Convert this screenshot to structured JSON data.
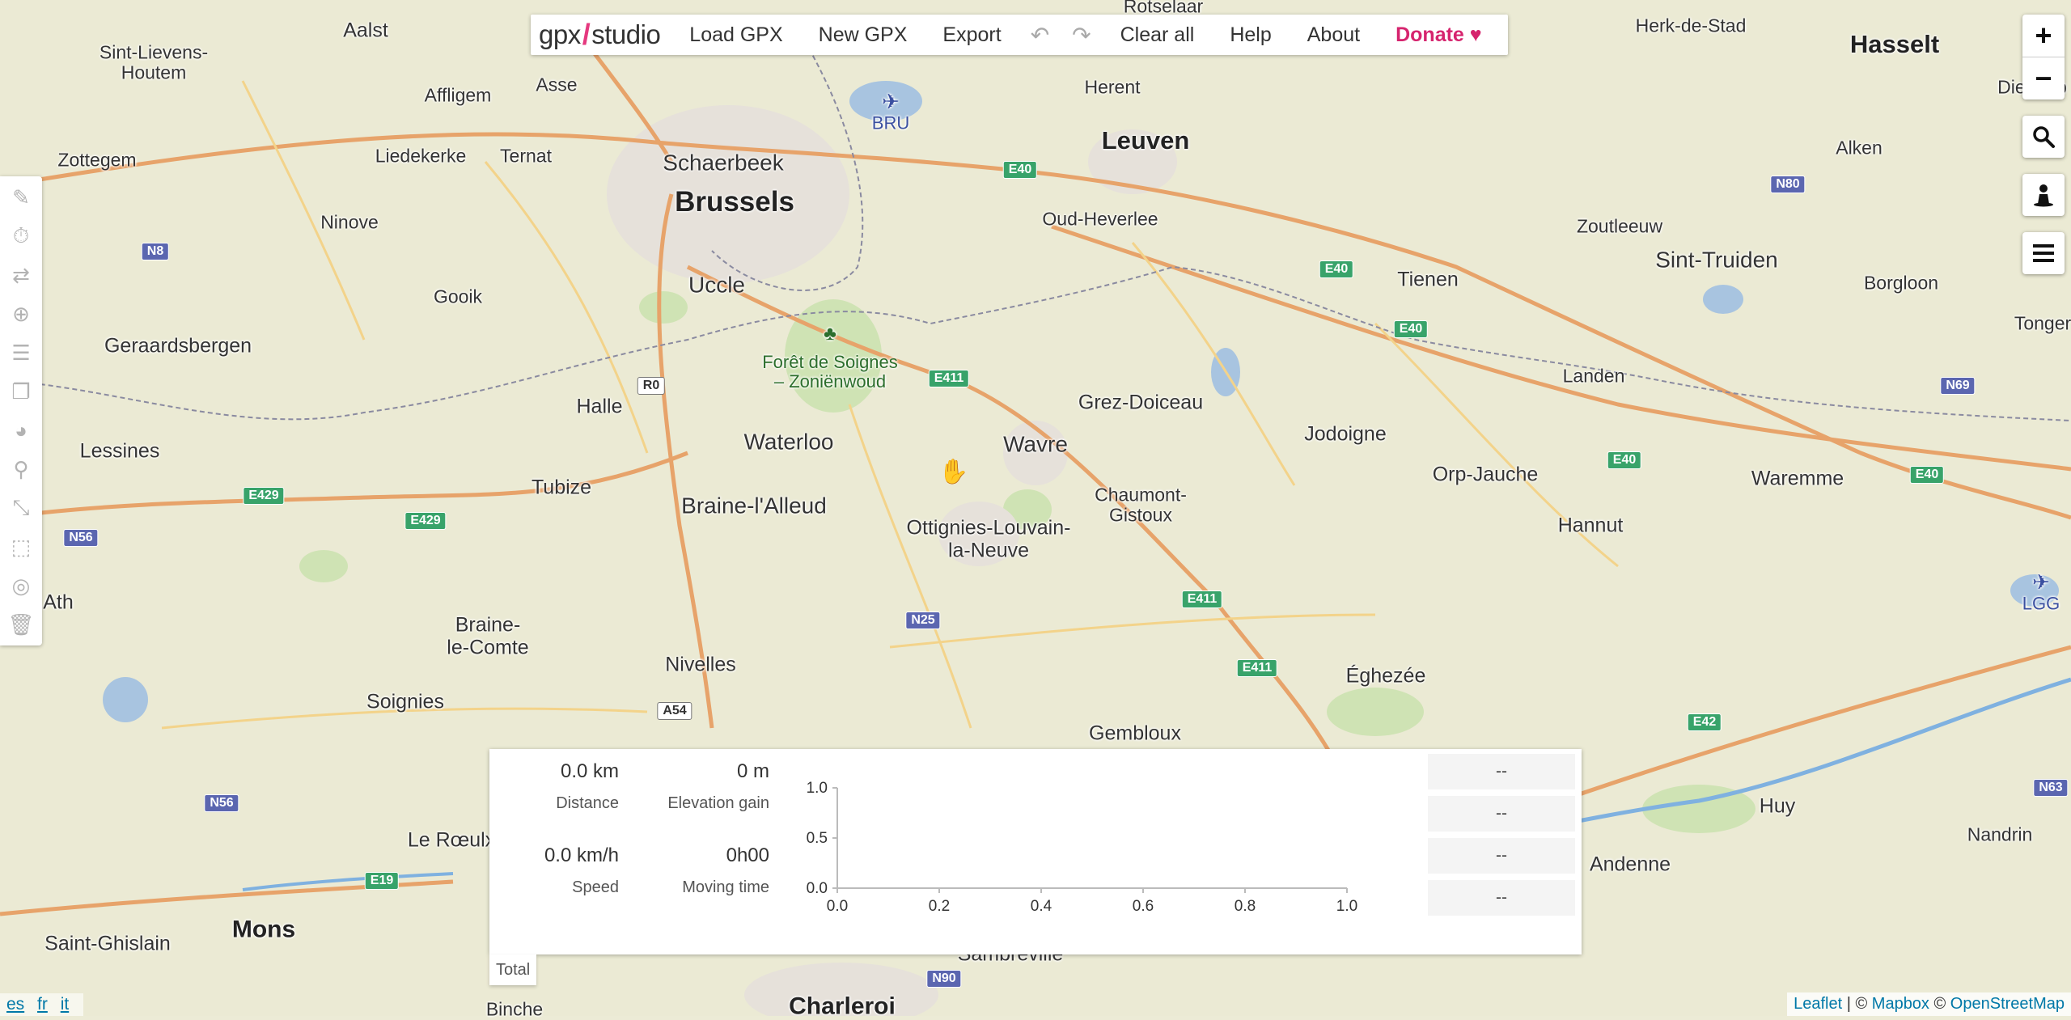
{
  "menu": {
    "logo_left": "gpx",
    "logo_right": "studio",
    "items": [
      "Load GPX",
      "New GPX",
      "Export"
    ],
    "undo_icon": "undo-icon",
    "redo_icon": "redo-icon",
    "items2": [
      "Clear all",
      "Help",
      "About"
    ],
    "donate": "Donate",
    "donate_icon": "heart-icon",
    "accent": "#d6246e"
  },
  "left_tools": [
    "pencil-icon",
    "stopwatch-icon",
    "reverse-icon",
    "add-circle-icon",
    "list-icon",
    "copy-icon",
    "palette-icon",
    "pin-icon",
    "compress-icon",
    "crop-icon",
    "eye-slash-icon",
    "trash-icon"
  ],
  "right_controls": {
    "zoom_in": "+",
    "zoom_out": "−",
    "search_icon": "search-icon",
    "street_view_icon": "person-icon",
    "layers_icon": "layers-icon"
  },
  "places": {
    "aalst": "Aalst",
    "sint_lievens": "Sint-Lievens-\nHoutem",
    "asse": "Asse",
    "affligem": "Affligem",
    "zottegem": "Zottegem",
    "liedekerke": "Liedekerke",
    "ternat": "Ternat",
    "schaerbeek": "Schaerbeek",
    "brussels": "Brussels",
    "herent": "Herent",
    "leuven": "Leuven",
    "rotselaar": "Rotselaar",
    "herk": "Herk-de-Stad",
    "hasselt": "Hasselt",
    "diepenbeek": "Diepenb",
    "alken": "Alken",
    "ninove": "Ninove",
    "uccle": "Uccle",
    "oud_heverlee": "Oud-Heverlee",
    "zoutleeuw": "Zoutleeuw",
    "sint_truiden": "Sint-Truiden",
    "tienen": "Tienen",
    "borgloon": "Borgloon",
    "tongeren": "Tonger",
    "gooik": "Gooik",
    "geraardsbergen": "Geraardsbergen",
    "foret": "Forêt de Soignes\n– Zoniënwoud",
    "landen": "Landen",
    "halle": "Halle",
    "waterloo": "Waterloo",
    "wavre": "Wavre",
    "grez": "Grez-Doiceau",
    "jodoigne": "Jodoigne",
    "lessines": "Lessines",
    "tubize": "Tubize",
    "braine_alleud": "Braine-l'Alleud",
    "chaumont": "Chaumont-\nGistoux",
    "orp": "Orp-Jauche",
    "waremme": "Waremme",
    "ottignies": "Ottignies-Louvain-\nla-Neuve",
    "hannut": "Hannut",
    "ath": "Ath",
    "braine_comte": "Braine-\nle-Comte",
    "nivelles": "Nivelles",
    "eghezee": "Éghezée",
    "soignies": "Soignies",
    "gembloux": "Gembloux",
    "huy": "Huy",
    "nandrin": "Nandrin",
    "andenne": "Andenne",
    "roeulx": "Le Rœulx",
    "mons": "Mons",
    "saint_ghislain": "Saint-Ghislain",
    "sambreville": "Sambreville",
    "charleroi": "Charleroi",
    "binche": "Binche",
    "bru": "BRU",
    "lgg": "LGG"
  },
  "shields": {
    "e40a": "E40",
    "e40b": "E40",
    "e40c": "E40",
    "e40d": "E40",
    "e40e": "E40",
    "n80": "N80",
    "n8": "N8",
    "r0": "R0",
    "e411a": "E411",
    "e411b": "E411",
    "e411c": "E411",
    "n69": "N69",
    "e429a": "E429",
    "e429b": "E429",
    "n56a": "N56",
    "n56b": "N56",
    "n25": "N25",
    "a54": "A54",
    "e42": "E42",
    "n63": "N63",
    "e19": "E19",
    "n90": "N90"
  },
  "stats": {
    "distance_value": "0.0 km",
    "distance_label": "Distance",
    "elevation_value": "0 m",
    "elevation_label": "Elevation gain",
    "speed_value": "0.0 km/h",
    "speed_label": "Speed",
    "moving_value": "0h00",
    "moving_label": "Moving time"
  },
  "side_cells": [
    "--",
    "--",
    "--",
    "--"
  ],
  "total_tab": "Total",
  "chart_data": {
    "type": "line",
    "x": [],
    "series": [],
    "xlim": [
      0.0,
      1.0
    ],
    "ylim": [
      0.0,
      1.0
    ],
    "x_ticks": [
      "0.0",
      "0.2",
      "0.4",
      "0.6",
      "0.8",
      "1.0"
    ],
    "y_ticks": [
      "0.0",
      "0.5",
      "1.0"
    ]
  },
  "languages": [
    "es",
    "fr",
    "it"
  ],
  "attribution": {
    "leaflet": "Leaflet",
    "sep1": " | © ",
    "mapbox": "Mapbox",
    "sep2": " © ",
    "osm": "OpenStreetMap"
  }
}
